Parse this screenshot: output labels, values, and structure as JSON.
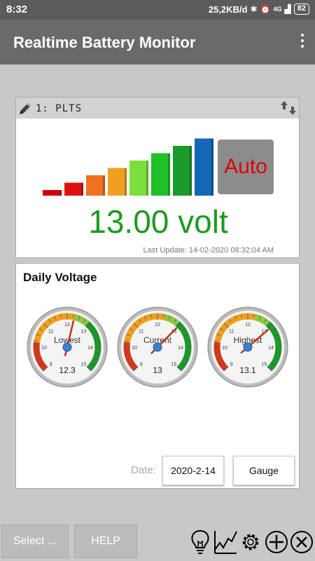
{
  "status": {
    "time": "8:32",
    "network": "25,2KB/d",
    "signal": "4G",
    "battery": "82"
  },
  "appbar": {
    "title": "Realtime Battery Monitor"
  },
  "monitor": {
    "name": "1:  PLTS",
    "auto_label": "Auto",
    "voltage": "13.00 volt",
    "last_update": "Last Update: 14-02-2020 08:32:04 AM",
    "level_bars": 8,
    "level_colors": [
      "#d00000",
      "#e01010",
      "#f07020",
      "#f0a020",
      "#7be03a",
      "#1fc02a",
      "#1a9a2a",
      "#1466b8"
    ]
  },
  "daily": {
    "title": "Daily Voltage",
    "gauges": [
      {
        "label": "Lowest",
        "value": "12.3",
        "reading": 12.3
      },
      {
        "label": "Current",
        "value": "13",
        "reading": 13.0
      },
      {
        "label": "Highest",
        "value": "13.1",
        "reading": 13.1
      }
    ],
    "scale_ticks": [
      "9",
      "10",
      "11",
      "12",
      "13",
      "14",
      "15"
    ],
    "date_label": "Date:",
    "date_value": "2020-2-14",
    "mode_button": "Gauge"
  },
  "bottom": {
    "select_label": "Select ...",
    "help_label": "HELP"
  },
  "colors": {
    "accent_green": "#1f9a1f",
    "auto_red": "#d00000"
  }
}
